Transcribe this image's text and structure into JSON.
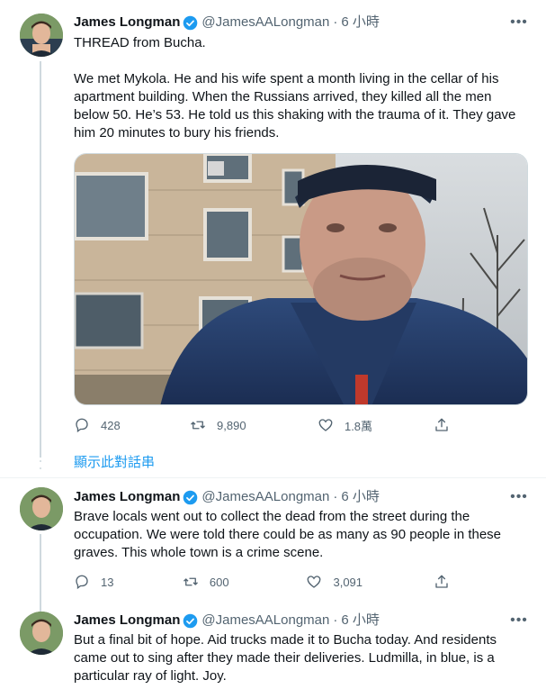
{
  "tweets": [
    {
      "name": "James Longman",
      "handle": "@JamesAALongman",
      "time": "6 小時",
      "text": "THREAD from Bucha.\n\nWe met Mykola. He and his wife spent a month living in the cellar of his apartment building. When the Russians arrived, they killed all the men below 50. He’s 53. He told us this shaking with the trauma of it. They gave him 20 minutes to bury his friends.",
      "replies": "428",
      "retweets": "9,890",
      "likes": "1.8萬"
    },
    {
      "name": "James Longman",
      "handle": "@JamesAALongman",
      "time": "6 小時",
      "text": "Brave locals went out to collect the dead from the street during the occupation. We were told there could be as many as 90 people in these graves. This whole town is a crime scene.",
      "replies": "13",
      "retweets": "600",
      "likes": "3,091"
    },
    {
      "name": "James Longman",
      "handle": "@JamesAALongman",
      "time": "6 小時",
      "text": "But a final bit of hope. Aid trucks made it to Bucha today. And residents came out to sing after they made their deliveries. Ludmilla, in blue, is a particular ray of light. Joy."
    }
  ],
  "show_thread": "顯示此對話串",
  "separator": "·",
  "more_glyph": "•••",
  "colors": {
    "accent": "#1d9bf0",
    "secondary": "#536471",
    "text": "#0f1419"
  },
  "icons": [
    "verified-badge-icon",
    "reply-icon",
    "retweet-icon",
    "like-icon",
    "share-icon",
    "more-icon"
  ]
}
